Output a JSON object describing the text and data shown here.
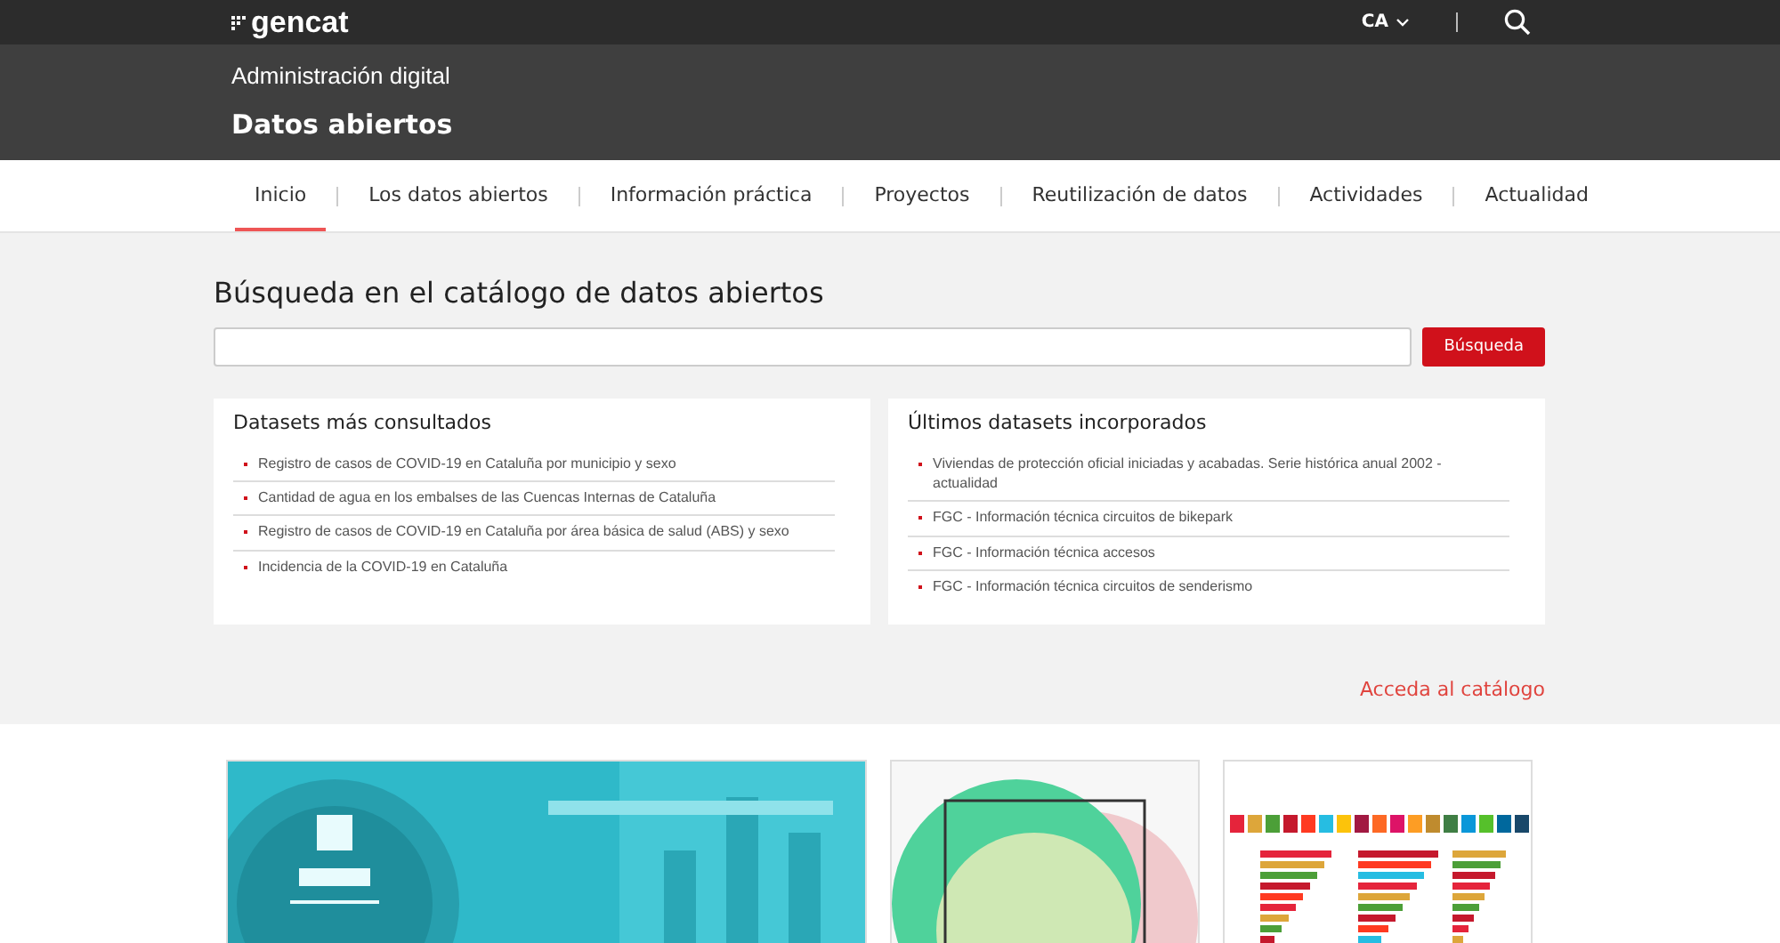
{
  "topbar": {
    "logo": "gencat",
    "language": "CA"
  },
  "header": {
    "subtitle": "Administración digital",
    "title": "Datos abiertos"
  },
  "nav": [
    {
      "label": "Inicio",
      "selected": true
    },
    {
      "label": "Los datos abiertos",
      "selected": false
    },
    {
      "label": "Información práctica",
      "selected": false
    },
    {
      "label": "Proyectos",
      "selected": false
    },
    {
      "label": "Reutilización de datos",
      "selected": false
    },
    {
      "label": "Actividades",
      "selected": false
    },
    {
      "label": "Actualidad",
      "selected": false
    }
  ],
  "search": {
    "title": "Búsqueda en el catálogo de datos abiertos",
    "button": "Búsqueda"
  },
  "panels": [
    {
      "title": "Datasets más consultados",
      "items": [
        "Registro de casos de COVID-19 en Cataluña por municipio y sexo",
        "Cantidad de agua en los embalses de las Cuencas Internas de Cataluña",
        "Registro de casos de COVID-19 en Cataluña por área básica de salud (ABS) y sexo",
        "Incidencia de la COVID-19 en Cataluña"
      ]
    },
    {
      "title": "Últimos datasets incorporados",
      "items": [
        "Viviendas de protección oficial iniciadas y acabadas. Serie histórica anual 2002 - actualidad",
        "FGC - Información técnica circuitos de bikepark",
        "FGC - Información técnica accesos",
        "FGC - Información técnica circuitos de senderismo"
      ]
    }
  ],
  "catalog_link": "Acceda al catálogo"
}
